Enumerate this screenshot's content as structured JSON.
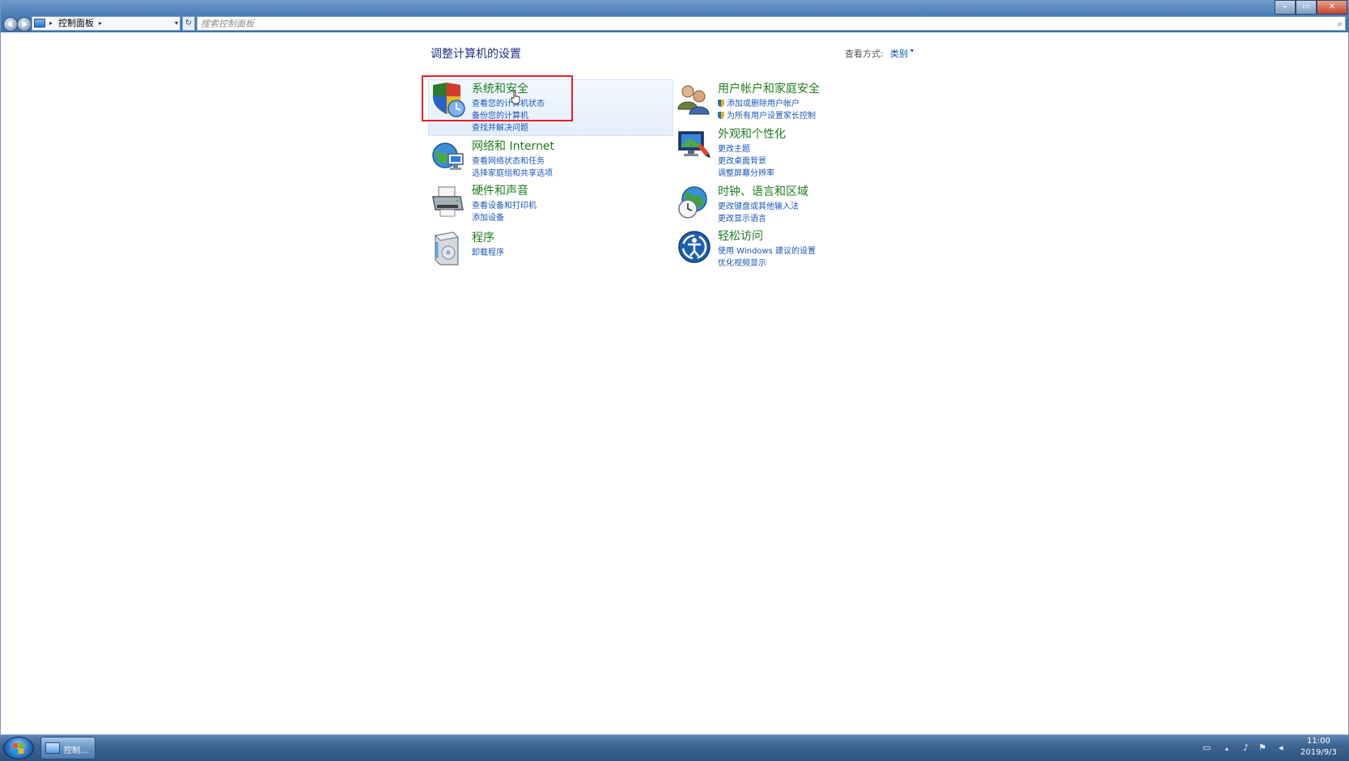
{
  "address_bar": {
    "breadcrumb": "控制面板",
    "search_placeholder": "搜索控制面板"
  },
  "header": {
    "title": "调整计算机的设置",
    "view_by_label": "查看方式:",
    "view_by_value": "类别"
  },
  "categories": [
    {
      "title": "系统和安全",
      "links": [
        "查看您的计算机状态",
        "备份您的计算机",
        "查找并解决问题"
      ]
    },
    {
      "title": "网络和 Internet",
      "links": [
        "查看网络状态和任务",
        "选择家庭组和共享选项"
      ]
    },
    {
      "title": "硬件和声音",
      "links": [
        "查看设备和打印机",
        "添加设备"
      ]
    },
    {
      "title": "程序",
      "links": [
        "卸载程序"
      ]
    },
    {
      "title": "用户帐户和家庭安全",
      "links": [
        "添加或删除用户帐户",
        "为所有用户设置家长控制"
      ]
    },
    {
      "title": "外观和个性化",
      "links": [
        "更改主题",
        "更改桌面背景",
        "调整屏幕分辨率"
      ]
    },
    {
      "title": "时钟、语言和区域",
      "links": [
        "更改键盘或其他输入法",
        "更改显示语言"
      ]
    },
    {
      "title": "轻松访问",
      "links": [
        "使用 Windows 建议的设置",
        "优化视频显示"
      ]
    }
  ],
  "taskbar": {
    "task_label": "控制...",
    "time": "11:00",
    "date": "2019/9/3"
  },
  "colors": {
    "category_title": "#1f7d1f",
    "link": "#1a56b8",
    "highlight_box": "#e5202a",
    "taskbar": "#3e6592"
  }
}
